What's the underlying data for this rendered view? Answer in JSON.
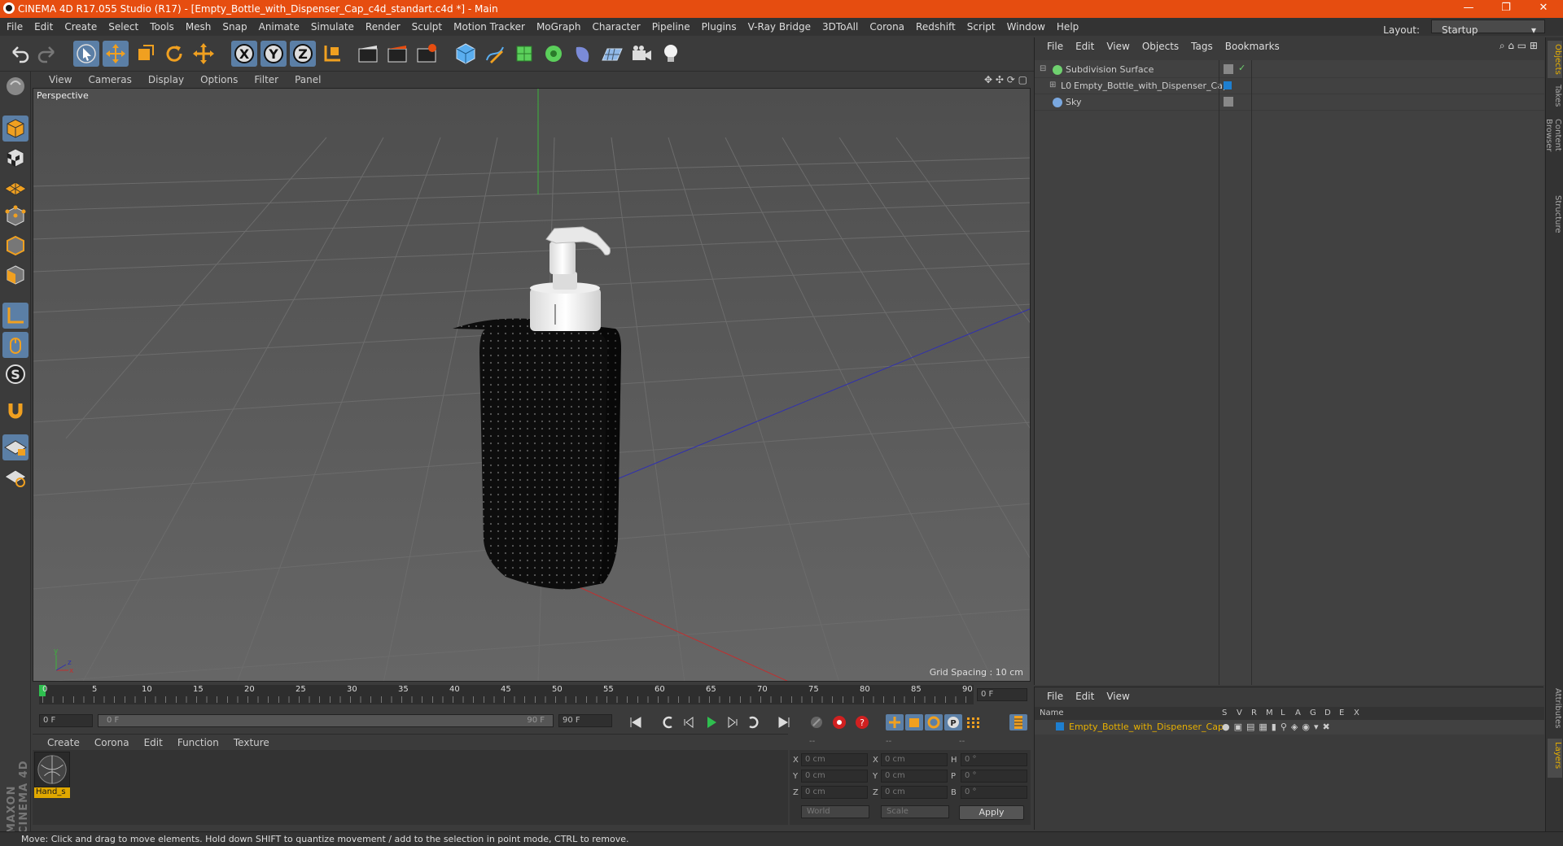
{
  "titlebar": {
    "title": "CINEMA 4D R17.055 Studio (R17) - [Empty_Bottle_with_Dispenser_Cap_c4d_standart.c4d *] - Main",
    "minimize": "—",
    "restore": "❐",
    "close": "✕"
  },
  "menubar": {
    "items": [
      "File",
      "Edit",
      "Create",
      "Select",
      "Tools",
      "Mesh",
      "Snap",
      "Animate",
      "Simulate",
      "Render",
      "Sculpt",
      "Motion Tracker",
      "MoGraph",
      "Character",
      "Pipeline",
      "Plugins",
      "V-Ray Bridge",
      "3DToAll",
      "Corona",
      "Redshift",
      "Script",
      "Window",
      "Help"
    ],
    "layout_label": "Layout:",
    "layout_value": "Startup"
  },
  "viewport": {
    "menu": [
      "View",
      "Cameras",
      "Display",
      "Options",
      "Filter",
      "Panel"
    ],
    "label": "Perspective",
    "grid_spacing": "Grid Spacing : 10 cm"
  },
  "timeline": {
    "ticks": [
      "0",
      "5",
      "10",
      "15",
      "20",
      "25",
      "30",
      "35",
      "40",
      "45",
      "50",
      "55",
      "60",
      "65",
      "70",
      "75",
      "80",
      "85",
      "90"
    ],
    "current_frame": "0 F",
    "start_field": "0 F",
    "range_start": "0 F",
    "range_end": "90 F",
    "end_field": "90 F"
  },
  "material_manager": {
    "menu": [
      "Create",
      "Corona",
      "Edit",
      "Function",
      "Texture"
    ],
    "material_name": "Hand_s"
  },
  "coordinates": {
    "headers": [
      "--",
      "--",
      "--"
    ],
    "rows": [
      {
        "l1": "X",
        "v1": "0 cm",
        "l2": "X",
        "v2": "0 cm",
        "l3": "H",
        "v3": "0 °"
      },
      {
        "l1": "Y",
        "v1": "0 cm",
        "l2": "Y",
        "v2": "0 cm",
        "l3": "P",
        "v3": "0 °"
      },
      {
        "l1": "Z",
        "v1": "0 cm",
        "l2": "Z",
        "v2": "0 cm",
        "l3": "B",
        "v3": "0 °"
      }
    ],
    "world": "World",
    "scale": "Scale",
    "apply": "Apply"
  },
  "object_manager": {
    "menu": [
      "File",
      "Edit",
      "View",
      "Objects",
      "Tags",
      "Bookmarks"
    ],
    "objects": [
      {
        "name": "Subdivision Surface",
        "icon_color": "#6fd16f"
      },
      {
        "name": "Empty_Bottle_with_Dispenser_Cap",
        "icon_color": "#cccccc"
      },
      {
        "name": "Sky",
        "icon_color": "#7aa8e0"
      }
    ]
  },
  "layer_manager": {
    "menu": [
      "File",
      "Edit",
      "View"
    ],
    "columns": [
      "Name",
      "S",
      "V",
      "R",
      "M",
      "L",
      "A",
      "G",
      "D",
      "E",
      "X"
    ],
    "layer_name": "Empty_Bottle_with_Dispenser_Cap",
    "layer_color": "#1e7fd0"
  },
  "right_tabs": [
    "Objects",
    "Takes",
    "Content Browser",
    "Structure",
    "Attributes",
    "Layers"
  ],
  "status": "Move: Click and drag to move elements. Hold down SHIFT to quantize movement / add to the selection in point mode, CTRL to remove.",
  "brand": "MAXON CINEMA 4D",
  "colors": {
    "accent": "#e64d10",
    "selection": "#5b7fa6",
    "material_highlight": "#e0a800"
  }
}
